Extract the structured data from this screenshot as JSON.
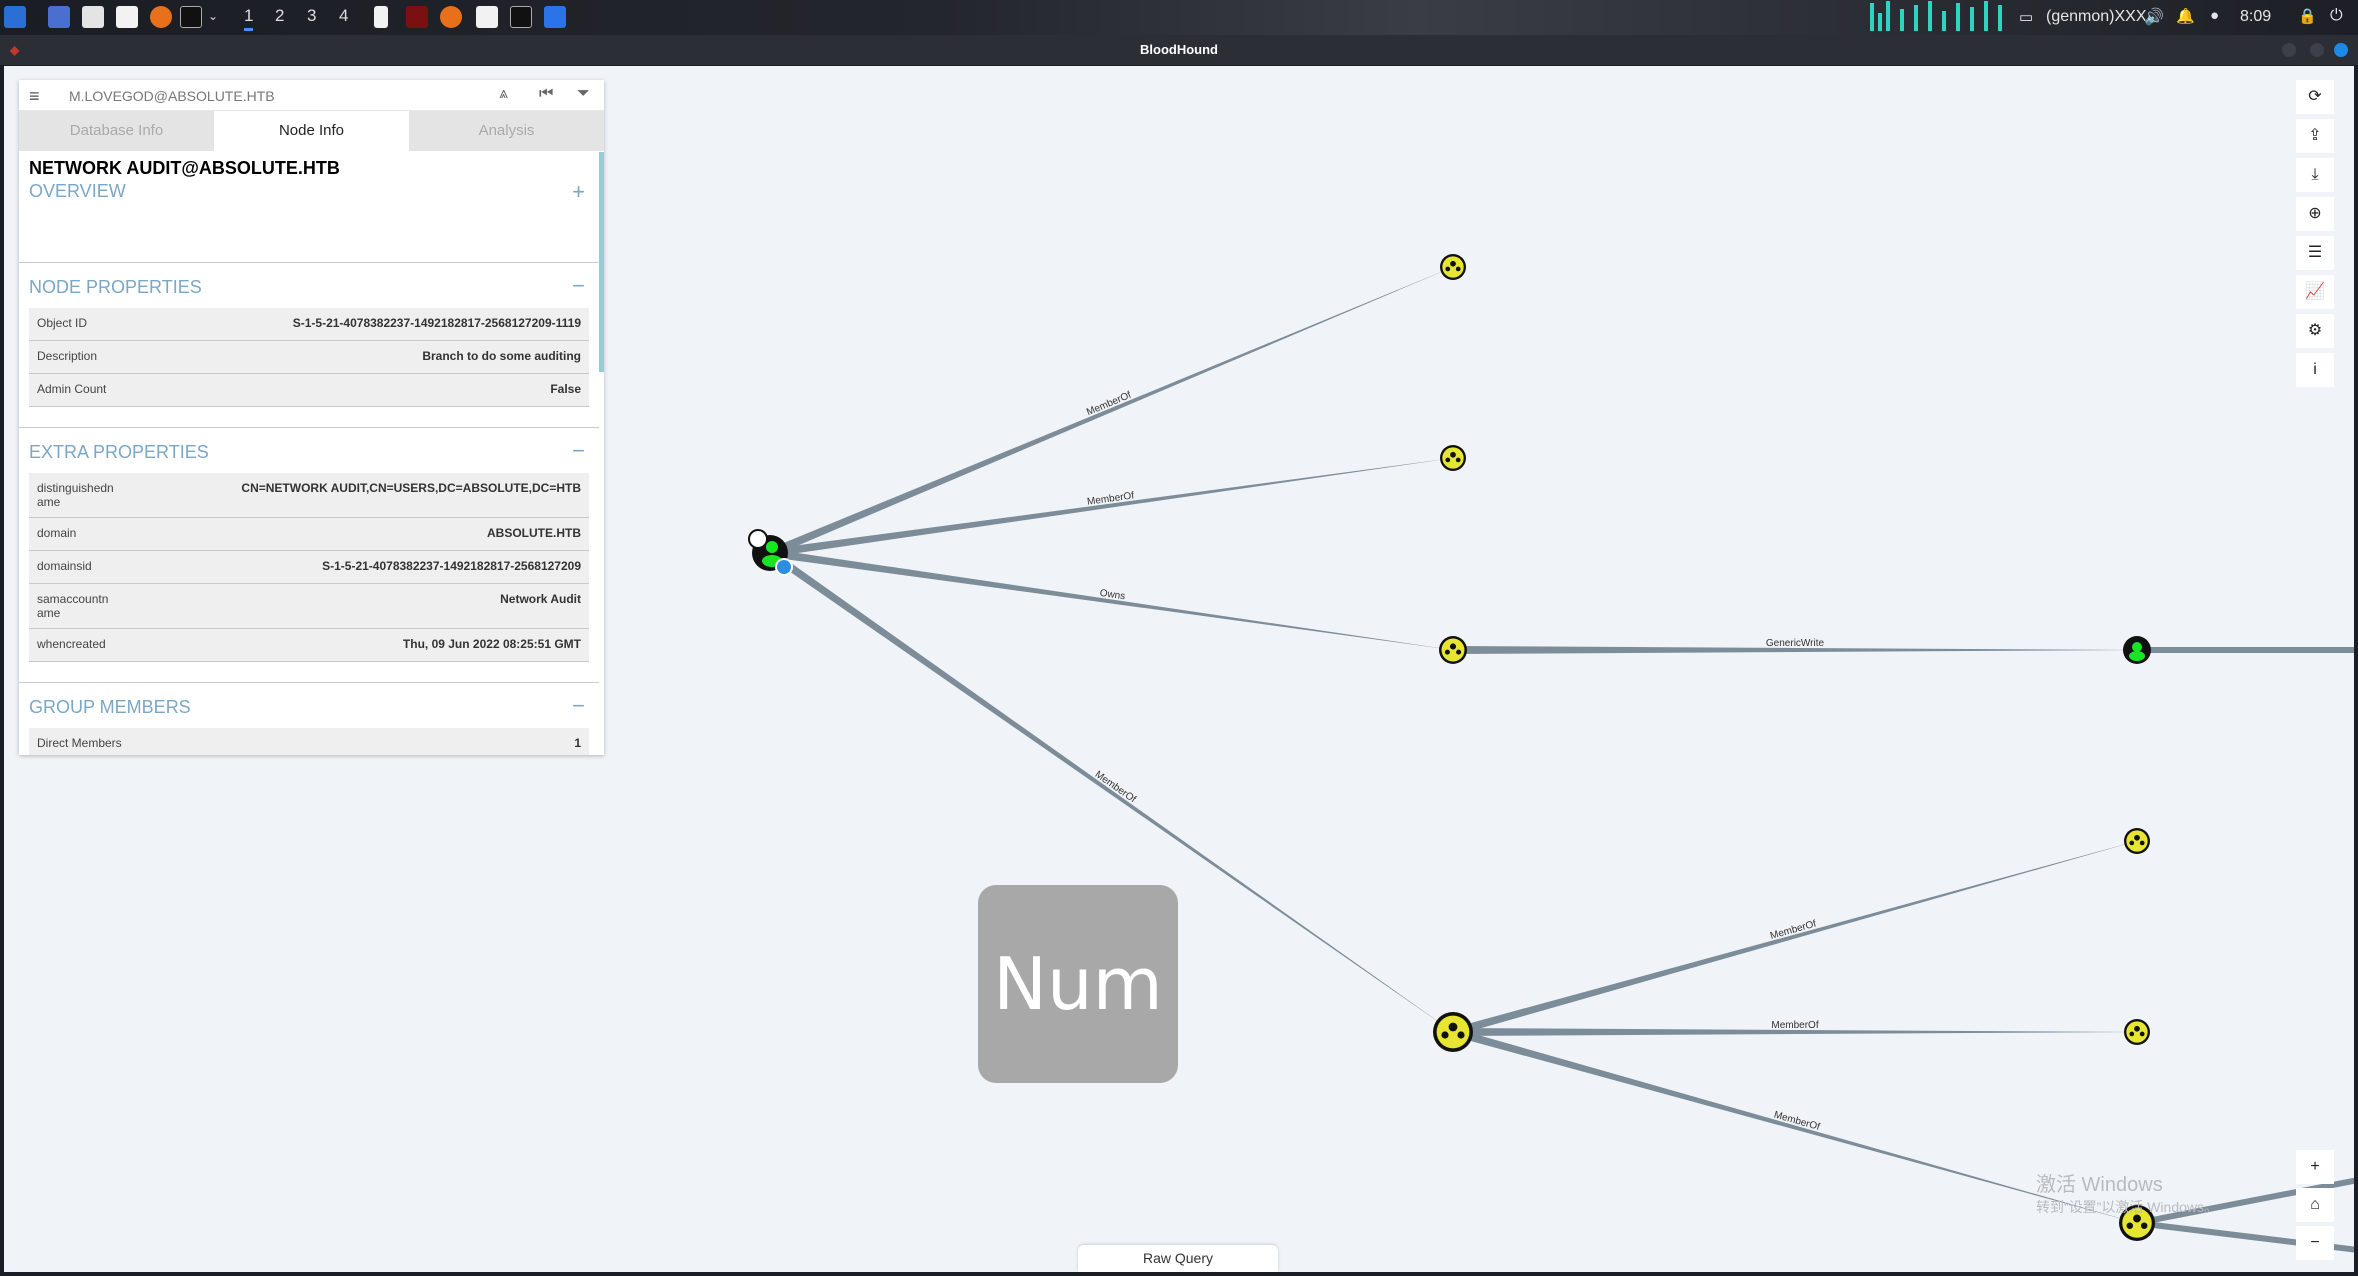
{
  "taskbar": {
    "workspaces": [
      "1",
      "2",
      "3",
      "4"
    ],
    "genmon": "(genmon)XXX",
    "clock": "8:09"
  },
  "window": {
    "title": "BloodHound"
  },
  "panel": {
    "search_value": "M.LOVEGOD@ABSOLUTE.HTB",
    "tabs": [
      "Database Info",
      "Node Info",
      "Analysis"
    ],
    "node_name": "NETWORK AUDIT@ABSOLUTE.HTB",
    "overview_label": "OVERVIEW",
    "node_properties_label": "NODE PROPERTIES",
    "node_properties": [
      {
        "key": "Object ID",
        "value": "S-1-5-21-4078382237-1492182817-2568127209-1119"
      },
      {
        "key": "Description",
        "value": "Branch to do some auditing"
      },
      {
        "key": "Admin Count",
        "value": "False"
      }
    ],
    "extra_properties_label": "EXTRA PROPERTIES",
    "extra_properties": [
      {
        "key": "distinguishedn ame",
        "value": "CN=NETWORK AUDIT,CN=USERS,DC=ABSOLUTE,DC=HTB"
      },
      {
        "key": "domain",
        "value": "ABSOLUTE.HTB"
      },
      {
        "key": "domainsid",
        "value": "S-1-5-21-4078382237-1492182817-2568127209"
      },
      {
        "key": "samaccountn ame",
        "value": "Network Audit"
      },
      {
        "key": "whencreated",
        "value": "Thu, 09 Jun 2022 08:25:51 GMT"
      }
    ],
    "group_members_label": "GROUP MEMBERS",
    "group_members_partial": "Direct Members",
    "group_members_count": "1"
  },
  "graph": {
    "edge_labels": [
      "MemberOf",
      "MemberOf",
      "Owns",
      "MemberOf",
      "GenericWrite",
      "MemberOf",
      "MemberOf",
      "MemberOf"
    ]
  },
  "overlay": {
    "num_label": "Num"
  },
  "raw_query_label": "Raw Query",
  "watermark": {
    "line1": "激活 Windows",
    "line2": "转到“设置”以激活 Windows。"
  },
  "colors": {
    "edge": "#7d8c99",
    "node_fill": "#e6e632",
    "user_fill": "#17e625",
    "accent": "#7aa7c7"
  },
  "icons": [
    "refresh-icon",
    "upload-icon",
    "download-icon",
    "upload-circle-icon",
    "list-icon",
    "chart-icon",
    "settings-icon",
    "info-icon",
    "zoom-in-icon",
    "home-icon",
    "zoom-out-icon"
  ]
}
